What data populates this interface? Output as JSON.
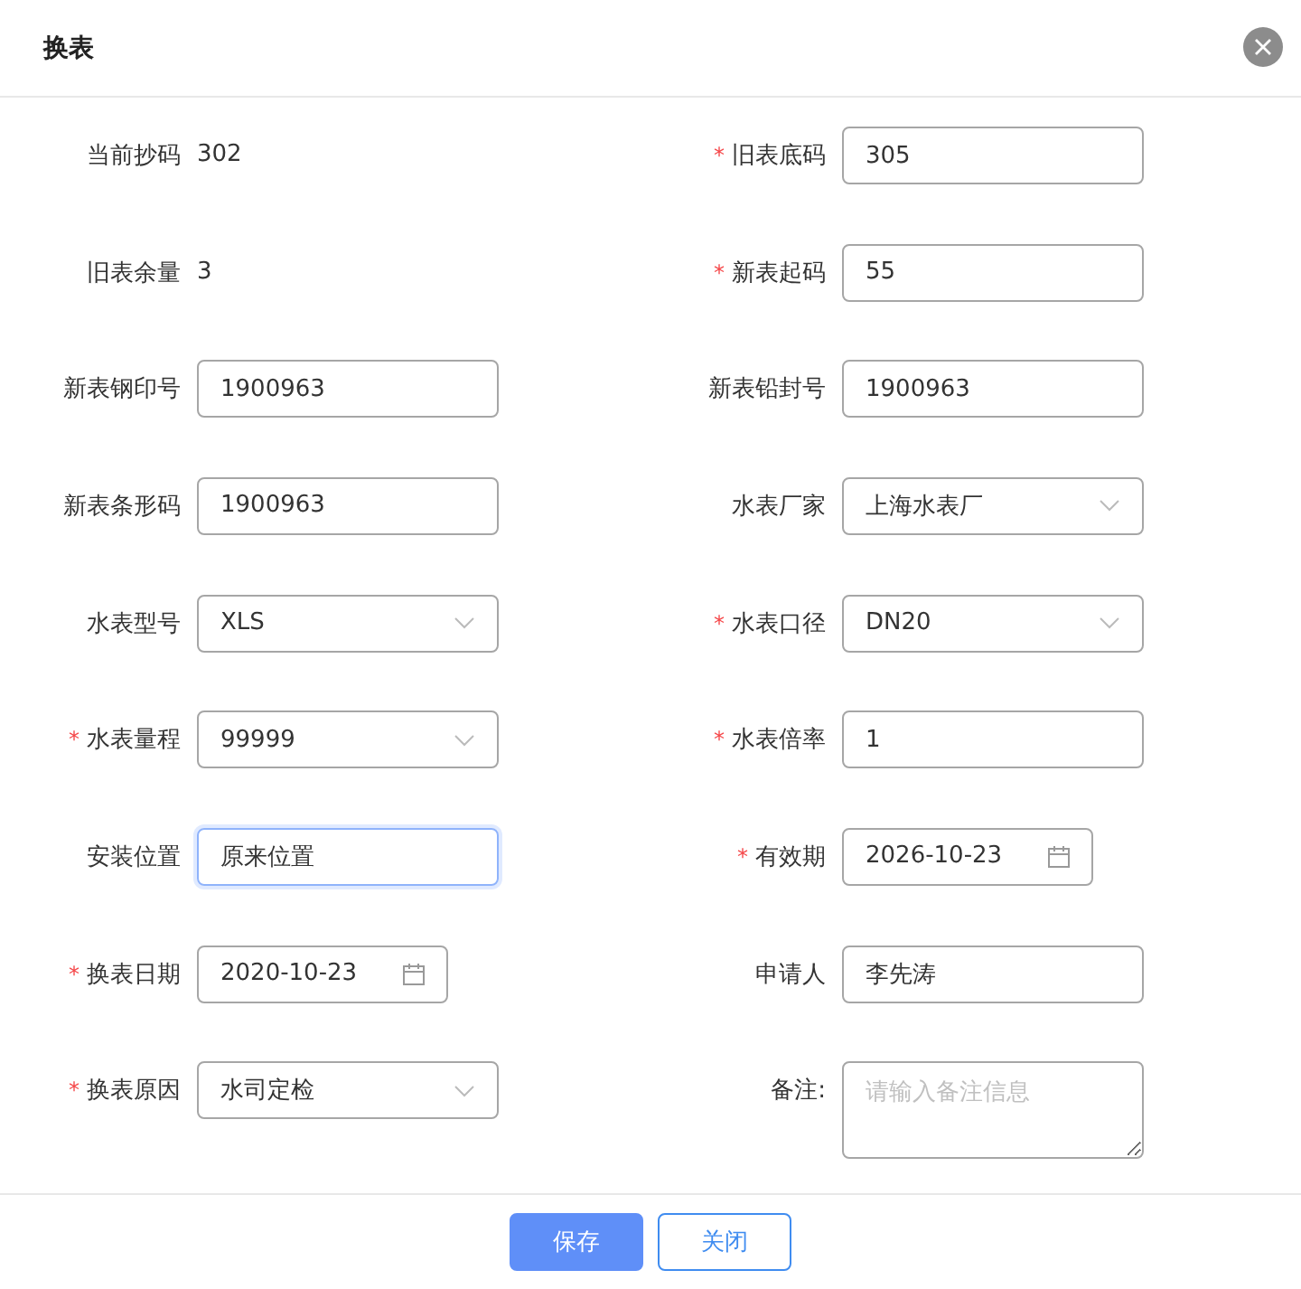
{
  "dialog": {
    "title": "换表"
  },
  "rows": [
    {
      "left": {
        "label": "当前抄码",
        "kind": "text",
        "value": "302"
      },
      "right": {
        "required_mark": "*",
        "label": "旧表底码",
        "kind": "input",
        "value": "305",
        "focused": false
      }
    },
    {
      "left": {
        "label": "旧表余量",
        "kind": "text",
        "value": "3"
      },
      "right": {
        "required_mark": "*",
        "label": "新表起码",
        "kind": "input",
        "value": "55",
        "focused": false
      }
    },
    {
      "left": {
        "label": "新表钢印号",
        "kind": "input",
        "value": "1900963",
        "focused": false
      },
      "right": {
        "label": "新表铅封号",
        "kind": "input",
        "value": "1900963",
        "focused": false
      }
    },
    {
      "left": {
        "label": "新表条形码",
        "kind": "input",
        "value": "1900963",
        "focused": false
      },
      "right": {
        "label": "水表厂家",
        "kind": "select",
        "value": "上海水表厂",
        "focused": false
      }
    },
    {
      "left": {
        "label": "水表型号",
        "kind": "select",
        "value": "XLS",
        "focused": false
      },
      "right": {
        "required_mark": "*",
        "label": "水表口径",
        "kind": "select",
        "value": "DN20",
        "focused": false
      }
    },
    {
      "left": {
        "required_mark": "*",
        "label": "水表量程",
        "kind": "select",
        "value": "99999",
        "focused": false
      },
      "right": {
        "required_mark": "*",
        "label": "水表倍率",
        "kind": "input",
        "value": "1",
        "focused": false
      }
    },
    {
      "left": {
        "label": "安装位置",
        "kind": "input",
        "value": "原来位置",
        "focused": true
      },
      "right": {
        "required_mark": "*",
        "label": "有效期",
        "kind": "date",
        "value": "2026-10-23",
        "focused": false
      }
    },
    {
      "left": {
        "required_mark": "*",
        "label": "换表日期",
        "kind": "date",
        "value": "2020-10-23",
        "focused": false
      },
      "right": {
        "label": "申请人",
        "kind": "input",
        "value": "李先涛",
        "focused": false
      }
    },
    {
      "left": {
        "required_mark": "*",
        "label": "换表原因",
        "kind": "select",
        "value": "水司定检",
        "focused": false
      },
      "right": {
        "label": "备注:",
        "kind": "textarea",
        "placeholder": "请输入备注信息",
        "focused": false
      }
    }
  ],
  "buttons": [
    {
      "label": "保存",
      "kind": "primary"
    },
    {
      "label": "关闭",
      "kind": "secondary"
    }
  ]
}
